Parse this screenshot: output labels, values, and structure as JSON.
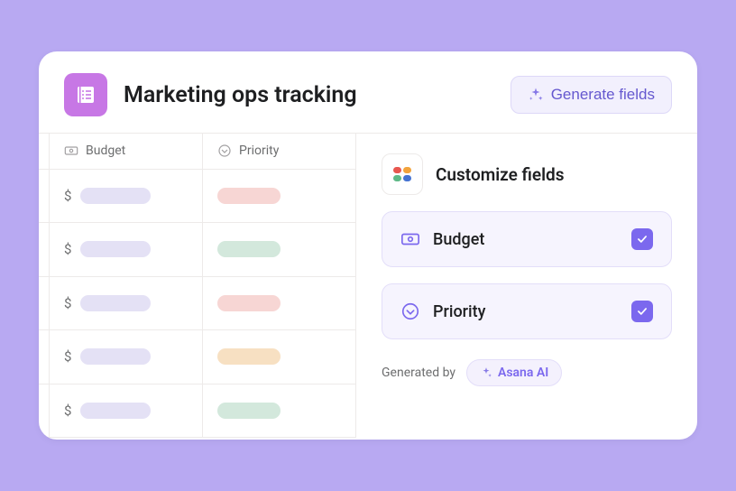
{
  "header": {
    "title": "Marketing ops tracking",
    "generate_button": "Generate fields"
  },
  "table": {
    "columns": [
      {
        "label": "Budget",
        "icon": "banknote-icon"
      },
      {
        "label": "Priority",
        "icon": "chevron-circle-icon"
      }
    ],
    "rows": [
      {
        "currency": "$",
        "budget_color": "c-lav",
        "priority_color": "c-red"
      },
      {
        "currency": "$",
        "budget_color": "c-lav",
        "priority_color": "c-grn"
      },
      {
        "currency": "$",
        "budget_color": "c-lav",
        "priority_color": "c-red"
      },
      {
        "currency": "$",
        "budget_color": "c-lav",
        "priority_color": "c-org"
      },
      {
        "currency": "$",
        "budget_color": "c-lav",
        "priority_color": "c-grn"
      }
    ]
  },
  "panel": {
    "title": "Customize fields",
    "fields": [
      {
        "label": "Budget",
        "icon": "banknote-icon",
        "checked": true
      },
      {
        "label": "Priority",
        "icon": "chevron-circle-icon",
        "checked": true
      }
    ],
    "generated_by_label": "Generated by",
    "ai_chip": "Asana AI"
  }
}
